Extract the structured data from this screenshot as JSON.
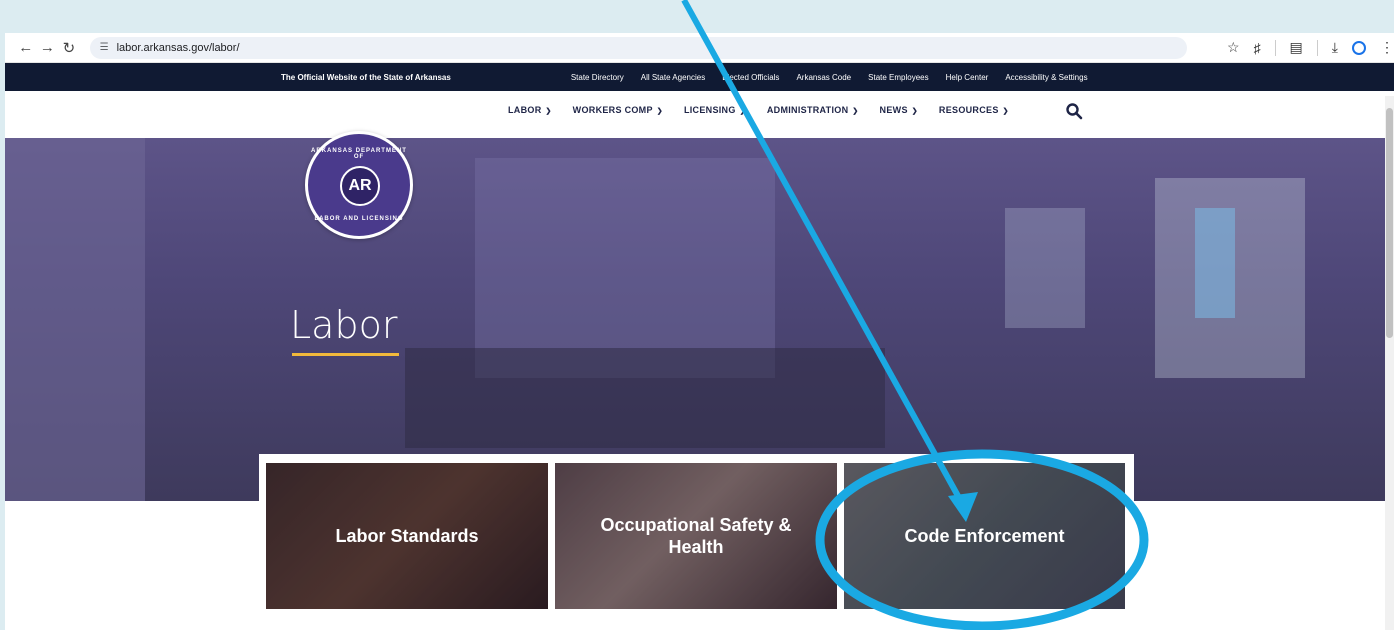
{
  "browser": {
    "url": "labor.arkansas.gov/labor/",
    "back_icon": "arrow-left-icon",
    "forward_icon": "arrow-right-icon",
    "reload_icon": "reload-icon"
  },
  "utility_bar": {
    "official": "The Official Website of the State of Arkansas",
    "links": [
      "State Directory",
      "All State Agencies",
      "Elected Officials",
      "Arkansas Code",
      "State Employees",
      "Help Center",
      "Accessibility & Settings"
    ]
  },
  "logo": {
    "top_text": "ARKANSAS DEPARTMENT OF",
    "bottom_text": "LABOR AND LICENSING",
    "center": "AR"
  },
  "nav": {
    "items": [
      "LABOR",
      "WORKERS COMP",
      "LICENSING",
      "ADMINISTRATION",
      "NEWS",
      "RESOURCES"
    ]
  },
  "hero": {
    "title": "Labor"
  },
  "cards": [
    {
      "label": "Labor Standards"
    },
    {
      "label": "Occupational Safety & Health"
    },
    {
      "label": "Code Enforcement"
    }
  ],
  "colors": {
    "utility_bg": "#101a33",
    "accent_underline": "#f2b93b",
    "annotation": "#1aa9e3"
  }
}
